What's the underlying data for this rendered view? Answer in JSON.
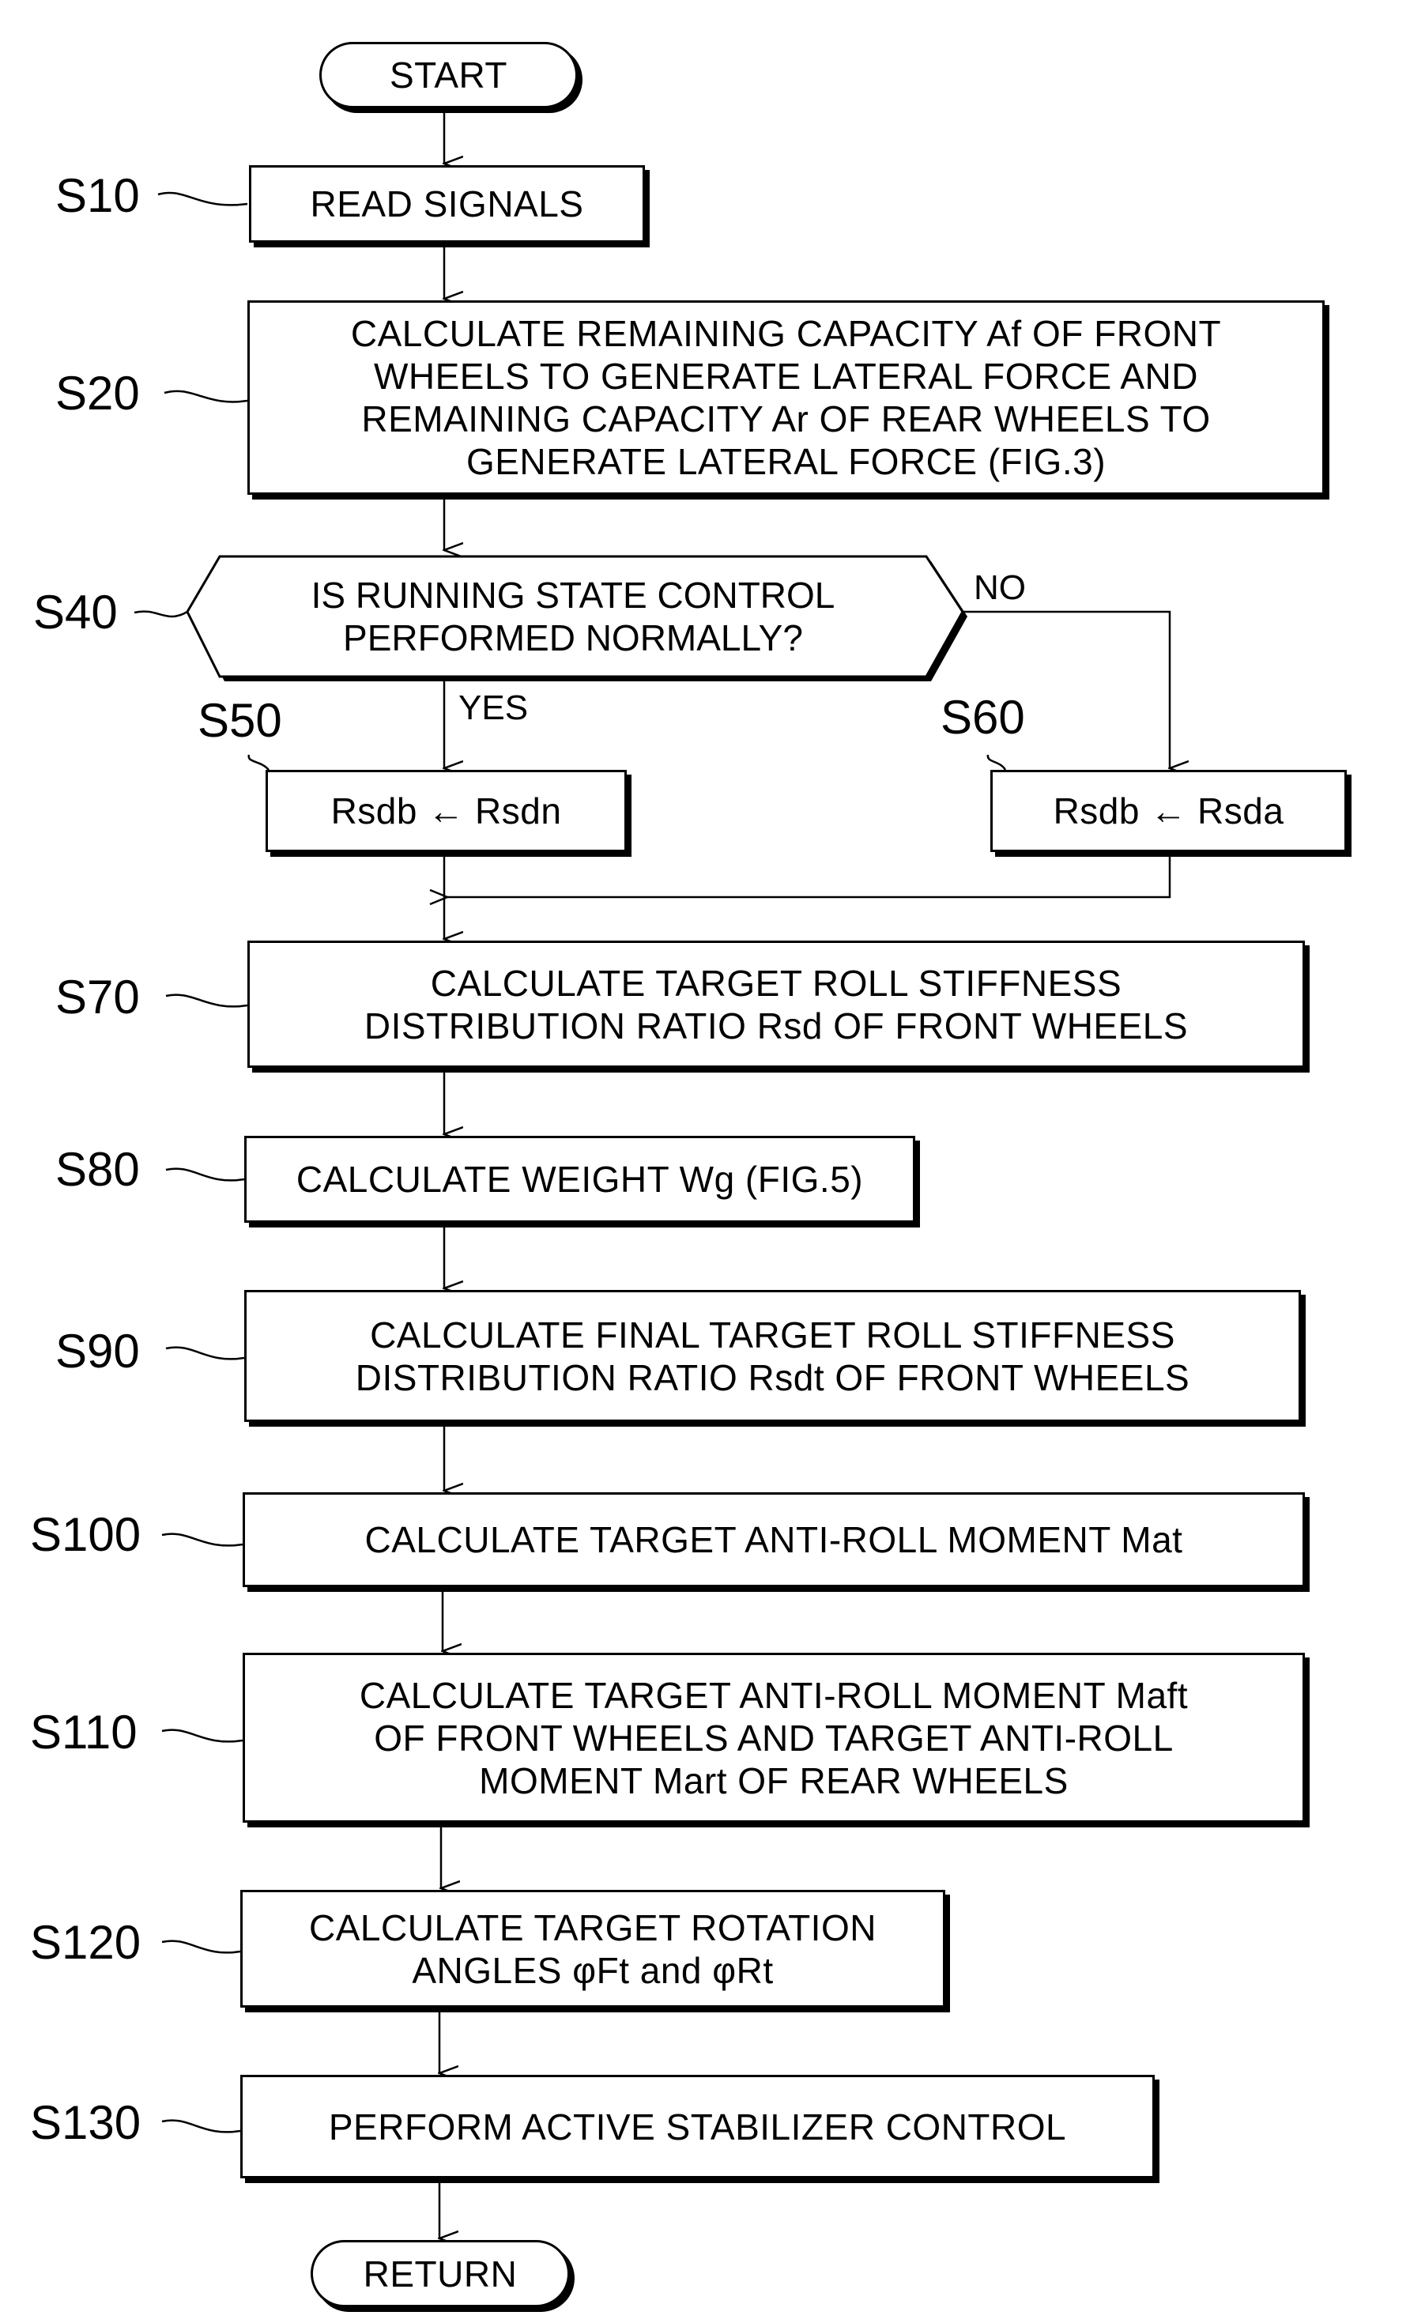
{
  "flowchart": {
    "start": "START",
    "end": "RETURN",
    "steps": [
      {
        "id": "S10",
        "text": "READ SIGNALS"
      },
      {
        "id": "S20",
        "text": "CALCULATE REMAINING CAPACITY Af OF FRONT\nWHEELS TO GENERATE LATERAL FORCE AND\nREMAINING CAPACITY Ar OF REAR WHEELS TO\nGENERATE LATERAL FORCE (FIG.3)"
      },
      {
        "id": "S40",
        "text": "IS RUNNING STATE CONTROL\nPERFORMED NORMALLY?",
        "type": "decision"
      },
      {
        "id": "S50",
        "text": "Rsdb ← Rsdn"
      },
      {
        "id": "S60",
        "text": "Rsdb ← Rsda"
      },
      {
        "id": "S70",
        "text": "CALCULATE TARGET ROLL STIFFNESS\nDISTRIBUTION RATIO Rsd OF FRONT WHEELS"
      },
      {
        "id": "S80",
        "text": "CALCULATE WEIGHT Wg (FIG.5)"
      },
      {
        "id": "S90",
        "text": "CALCULATE FINAL TARGET ROLL STIFFNESS\nDISTRIBUTION RATIO Rsdt OF FRONT WHEELS"
      },
      {
        "id": "S100",
        "text": "CALCULATE TARGET ANTI-ROLL MOMENT Mat"
      },
      {
        "id": "S110",
        "text": "CALCULATE TARGET ANTI-ROLL MOMENT Maft\nOF FRONT WHEELS AND TARGET ANTI-ROLL\nMOMENT Mart OF REAR WHEELS"
      },
      {
        "id": "S120",
        "text": "CALCULATE TARGET ROTATION\nANGLES φFt and φRt"
      },
      {
        "id": "S130",
        "text": "PERFORM ACTIVE STABILIZER CONTROL"
      }
    ],
    "branches": {
      "yes": "YES",
      "no": "NO"
    }
  }
}
